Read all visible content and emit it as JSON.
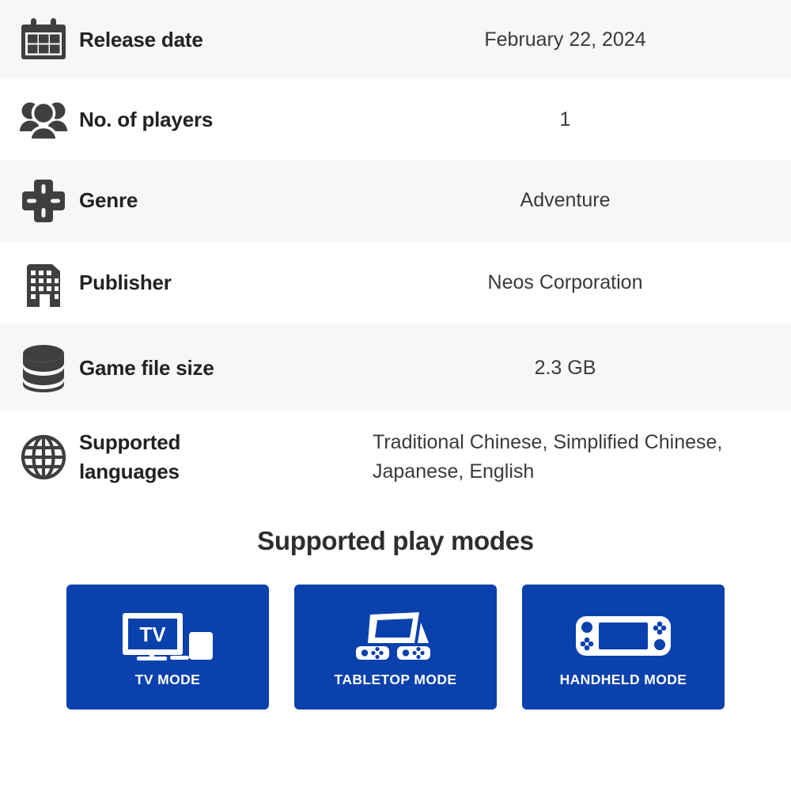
{
  "colors": {
    "accent_blue": "#0a41ad",
    "stripe_gray": "#f7f7f7",
    "page_white": "#ffffff",
    "icon_gray": "#3f3f3f",
    "label_text": "#222222",
    "value_text": "#3a3a3a"
  },
  "spec_rows": [
    {
      "icon": "calendar-icon",
      "label": "Release date",
      "value": "February 22, 2024",
      "striped": true
    },
    {
      "icon": "players-icon",
      "label": "No. of players",
      "value": "1",
      "striped": false
    },
    {
      "icon": "dpad-icon",
      "label": "Genre",
      "value": "Adventure",
      "striped": true
    },
    {
      "icon": "building-icon",
      "label": "Publisher",
      "value": "Neos Corporation",
      "striped": false
    },
    {
      "icon": "database-icon",
      "label": "Game file size",
      "value": "2.3 GB",
      "striped": true
    },
    {
      "icon": "globe-icon",
      "label": "Supported languages",
      "value": "Traditional Chinese, Simplified Chinese, Japanese, English",
      "striped": false
    }
  ],
  "play_modes": {
    "heading": "Supported play modes",
    "cards": [
      {
        "icon": "tv-mode-icon",
        "label": "TV MODE",
        "screen_text": "TV"
      },
      {
        "icon": "tabletop-mode-icon",
        "label": "TABLETOP MODE"
      },
      {
        "icon": "handheld-mode-icon",
        "label": "HANDHELD MODE"
      }
    ]
  }
}
